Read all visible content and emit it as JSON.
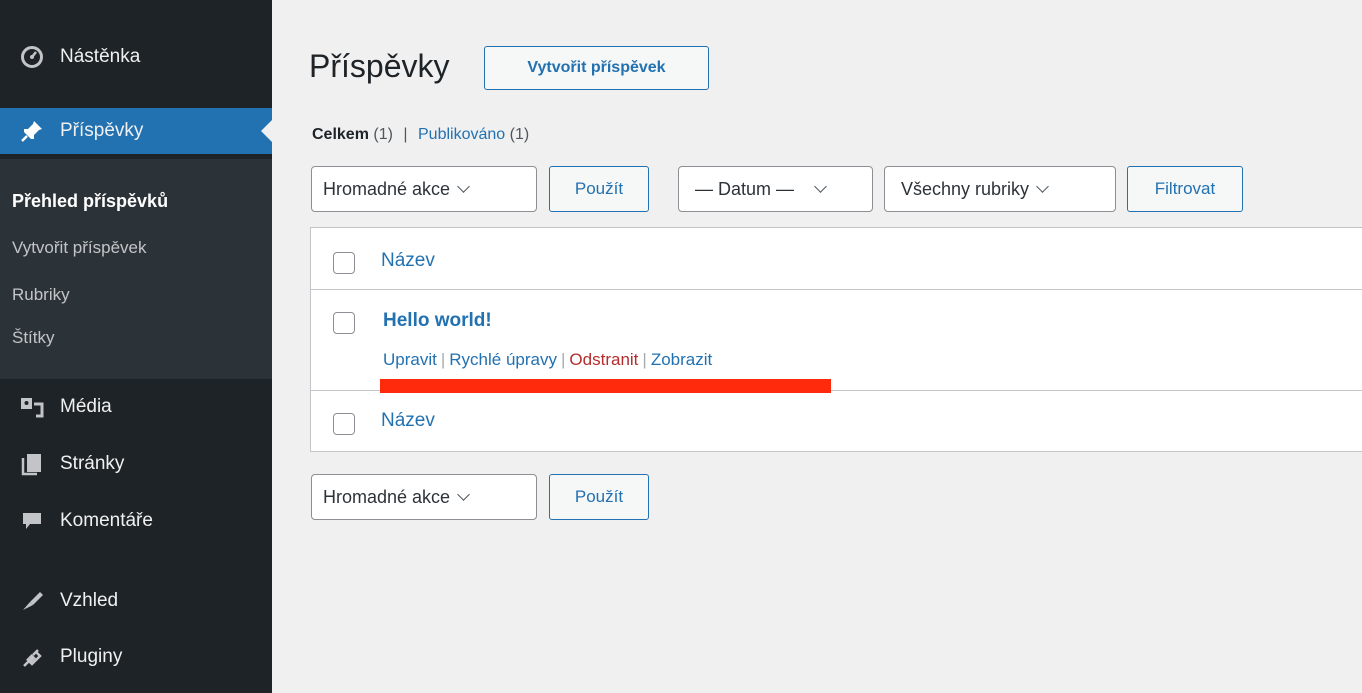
{
  "sidebar": {
    "items": [
      {
        "label": "Nástěnka",
        "icon": "dashboard-icon"
      },
      {
        "label": "Příspěvky",
        "icon": "pin-icon",
        "active": true
      },
      {
        "label": "Média",
        "icon": "media-icon"
      },
      {
        "label": "Stránky",
        "icon": "pages-icon"
      },
      {
        "label": "Komentáře",
        "icon": "comments-icon"
      },
      {
        "label": "Vzhled",
        "icon": "appearance-icon"
      },
      {
        "label": "Pluginy",
        "icon": "plugins-icon"
      }
    ],
    "submenu": [
      "Přehled příspěvků",
      "Vytvořit příspěvek",
      "Rubriky",
      "Štítky"
    ]
  },
  "main": {
    "title": "Příspěvky",
    "add_new": "Vytvořit příspěvek",
    "views": {
      "all_label": "Celkem",
      "all_count": "(1)",
      "separator": "|",
      "published_label": "Publikováno",
      "published_count": "(1)"
    },
    "filters": {
      "bulk_actions": "Hromadné akce",
      "apply": "Použít",
      "date": "— Datum —",
      "categories": "Všechny rubriky",
      "filter": "Filtrovat"
    },
    "table": {
      "column_title": "Název",
      "row": {
        "title": "Hello world!",
        "actions": [
          "Upravit",
          "Rychlé úpravy",
          "Odstranit",
          "Zobrazit"
        ],
        "action_separator": "|"
      },
      "footer_title": "Název"
    },
    "bottom": {
      "bulk_actions": "Hromadné akce",
      "apply": "Použít"
    },
    "highlight_color": "#ff2a0b"
  }
}
